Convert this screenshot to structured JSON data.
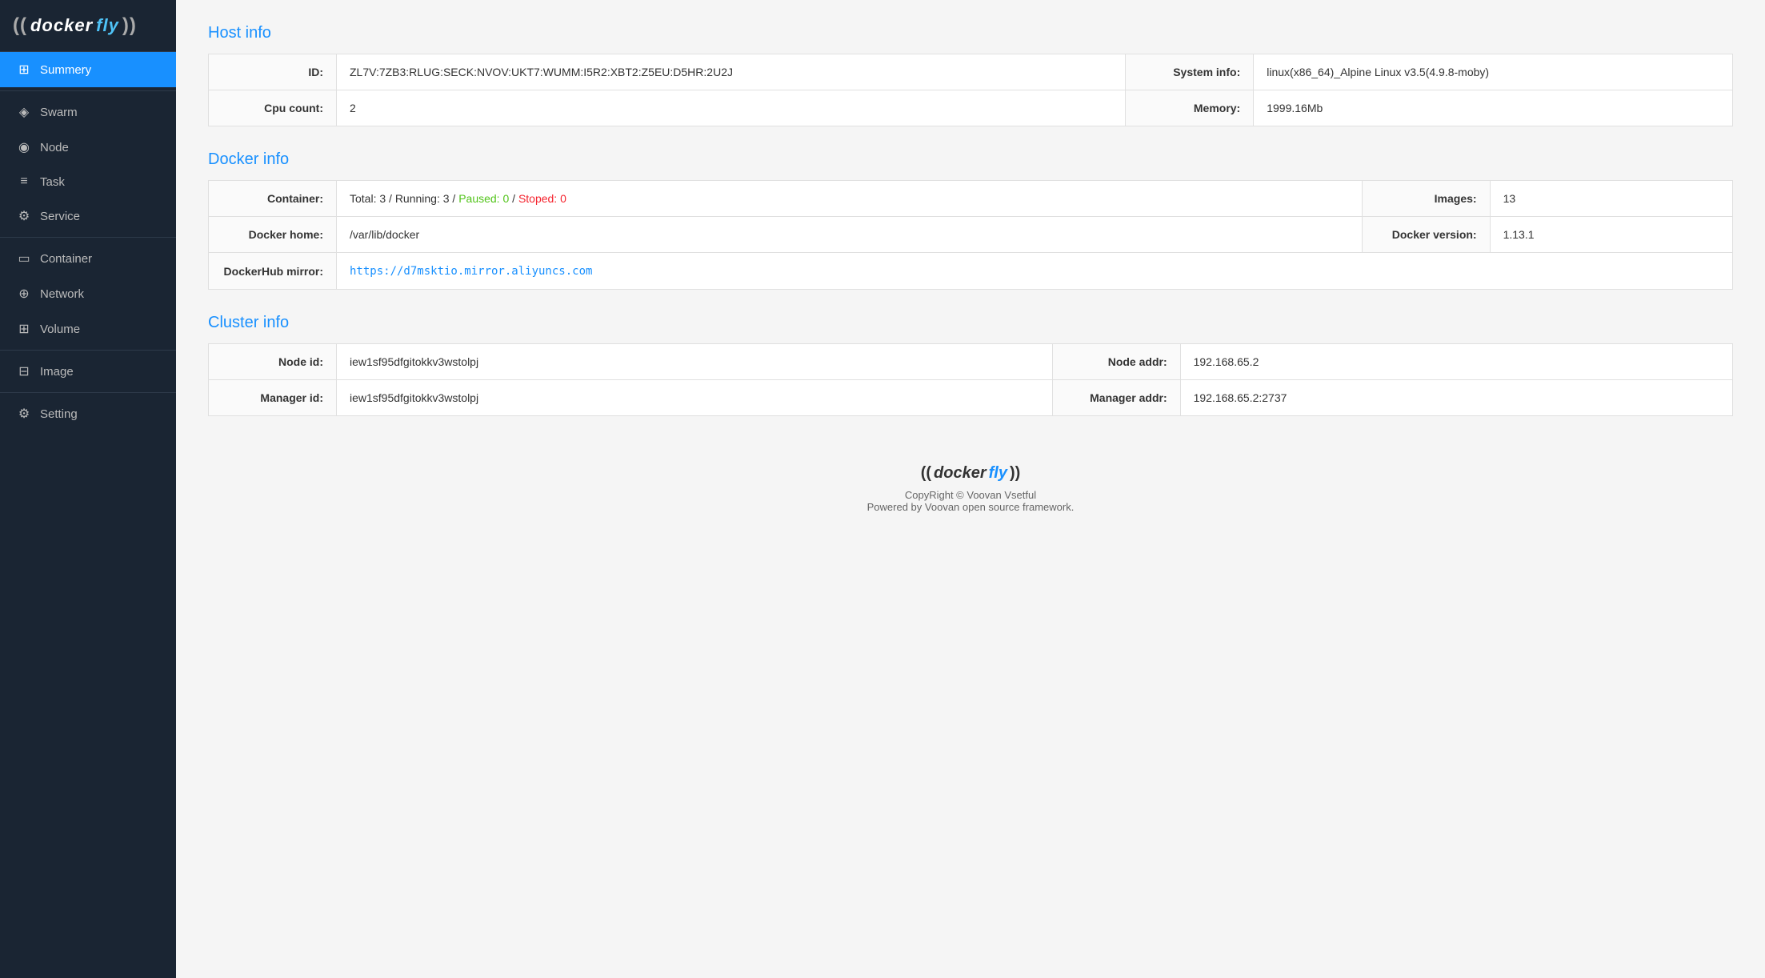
{
  "brand": {
    "logo_text": "dockerfly",
    "logo_display": "((dockerfly))"
  },
  "sidebar": {
    "items": [
      {
        "id": "summery",
        "label": "Summery",
        "icon": "⊞",
        "active": true
      },
      {
        "id": "swarm",
        "label": "Swarm",
        "icon": "◈",
        "active": false
      },
      {
        "id": "node",
        "label": "Node",
        "icon": "◉",
        "active": false
      },
      {
        "id": "task",
        "label": "Task",
        "icon": "≡",
        "active": false
      },
      {
        "id": "service",
        "label": "Service",
        "icon": "⚙",
        "active": false
      },
      {
        "id": "container",
        "label": "Container",
        "icon": "▭",
        "active": false
      },
      {
        "id": "network",
        "label": "Network",
        "icon": "⊕",
        "active": false
      },
      {
        "id": "volume",
        "label": "Volume",
        "icon": "⊞",
        "active": false
      },
      {
        "id": "image",
        "label": "Image",
        "icon": "⊟",
        "active": false
      },
      {
        "id": "setting",
        "label": "Setting",
        "icon": "⚙",
        "active": false
      }
    ]
  },
  "host_info": {
    "title": "Host info",
    "id_label": "ID:",
    "id_value": "ZL7V:7ZB3:RLUG:SECK:NVOV:UKT7:WUMM:I5R2:XBT2:Z5EU:D5HR:2U2J",
    "system_info_label": "System info:",
    "system_info_value": "linux(x86_64)_Alpine Linux v3.5(4.9.8-moby)",
    "cpu_count_label": "Cpu count:",
    "cpu_count_value": "2",
    "memory_label": "Memory:",
    "memory_value": "1999.16Mb"
  },
  "docker_info": {
    "title": "Docker info",
    "container_label": "Container:",
    "container_total": "Total: 3",
    "container_running": "Running: 3",
    "container_paused": "Paused: 0",
    "container_stopped": "Stoped: 0",
    "images_label": "Images:",
    "images_value": "13",
    "docker_home_label": "Docker home:",
    "docker_home_value": "/var/lib/docker",
    "docker_version_label": "Docker version:",
    "docker_version_value": "1.13.1",
    "dockerhub_mirror_label": "DockerHub mirror:",
    "dockerhub_mirror_value": "https://d7msktio.mirror.aliyuncs.com"
  },
  "cluster_info": {
    "title": "Cluster info",
    "node_id_label": "Node id:",
    "node_id_value": "iew1sf95dfgitokkv3wstolpj",
    "node_addr_label": "Node addr:",
    "node_addr_value": "192.168.65.2",
    "manager_id_label": "Manager id:",
    "manager_id_value": "iew1sf95dfgitokkv3wstolpj",
    "manager_addr_label": "Manager addr:",
    "manager_addr_value": "192.168.65.2:2737"
  },
  "footer": {
    "logo": "((dockerfly))",
    "copyright": "CopyRight © Voovan Vsetful",
    "powered": "Powered by Voovan open source framework."
  }
}
